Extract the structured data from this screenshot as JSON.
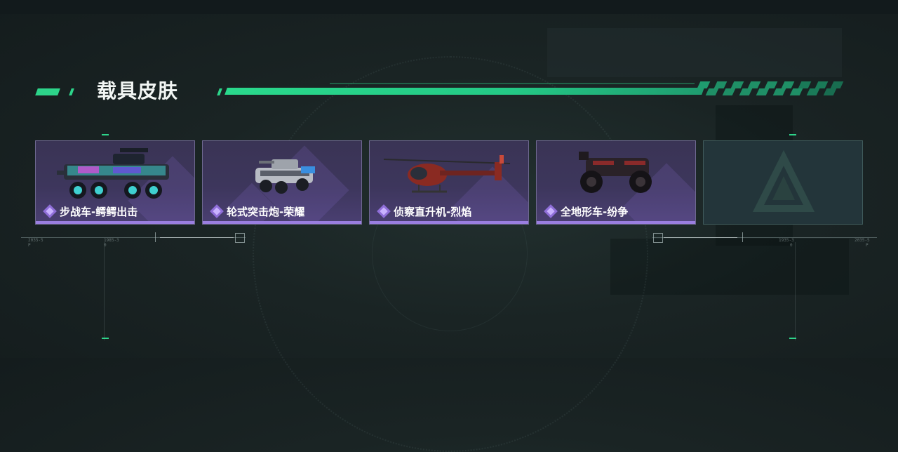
{
  "header": {
    "title": "载具皮肤"
  },
  "skins": [
    {
      "label": "步战车-鳄鳄出击",
      "vehicle": "armored-vehicle-icon"
    },
    {
      "label": "轮式突击炮-荣耀",
      "vehicle": "assault-gun-icon"
    },
    {
      "label": "侦察直升机-烈焰",
      "vehicle": "helicopter-icon"
    },
    {
      "label": "全地形车-纷争",
      "vehicle": "atv-icon"
    },
    {
      "label": "",
      "vehicle": "game-logo-icon"
    }
  ],
  "hud": {
    "left_outer": "2035-5",
    "left_inner": "1985-3",
    "right_inner": "1935-3",
    "right_outer": "2035-5",
    "sub_left": "P",
    "sub_left_inner": "0",
    "sub_right_inner": "0",
    "sub_right": "P"
  },
  "colors": {
    "accent": "#2dd48a",
    "card_border": "#6e6890",
    "card_underline": "#9a7ee0"
  }
}
